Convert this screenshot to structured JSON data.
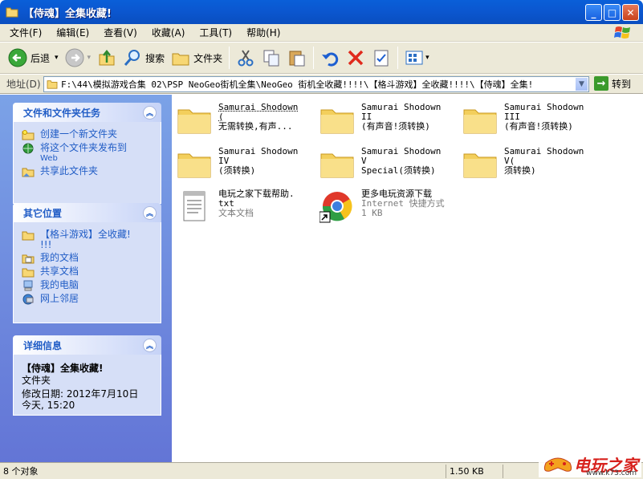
{
  "window": {
    "title": "【侍魂】全集收藏!"
  },
  "window_buttons": {
    "minimize": "_",
    "maximize": "□",
    "close": "✕"
  },
  "menu": [
    "文件(F)",
    "编辑(E)",
    "查看(V)",
    "收藏(A)",
    "工具(T)",
    "帮助(H)"
  ],
  "toolbar": {
    "back": "后退",
    "search": "搜索",
    "folders": "文件夹",
    "back_dropdown": "▾",
    "views_dropdown": "▾"
  },
  "address": {
    "label": "地址(D)",
    "path": "F:\\44\\模拟游戏合集 02\\PSP NeoGeo街机全集\\NeoGeo 街机全收藏!!!!\\【格斗游戏】全收藏!!!!\\【侍魂】全集!",
    "dropdown": "▼",
    "go_icon": "→",
    "go": "转到"
  },
  "tasks": {
    "title": "文件和文件夹任务",
    "collapse": "︽",
    "items": [
      {
        "label": "创建一个新文件夹",
        "sub": ""
      },
      {
        "label": "将这个文件夹发布到",
        "sub": "Web"
      },
      {
        "label": "共享此文件夹",
        "sub": ""
      }
    ]
  },
  "other": {
    "title": "其它位置",
    "collapse": "︽",
    "items": [
      {
        "label": "【格斗游戏】全收藏!",
        "sub": "!!!"
      },
      {
        "label": "我的文档",
        "sub": ""
      },
      {
        "label": "共享文档",
        "sub": ""
      },
      {
        "label": "我的电脑",
        "sub": ""
      },
      {
        "label": "网上邻居",
        "sub": ""
      }
    ]
  },
  "details": {
    "title": "详细信息",
    "collapse": "︽",
    "name": "【侍魂】全集收藏!",
    "type": "文件夹",
    "modified_label": "修改日期:",
    "modified_date": "2012年7月10日",
    "modified_time": "今天, 15:20"
  },
  "files": [
    {
      "line1": "Samurai Shodown (",
      "line2": "无需转换,有声...",
      "sub": "",
      "kind": "folder"
    },
    {
      "line1": "Samurai Shodown II",
      "line2": "(有声音!须转换)",
      "sub": "",
      "kind": "folder"
    },
    {
      "line1": "Samurai Shodown III",
      "line2": "(有声音!须转换)",
      "sub": "",
      "kind": "folder"
    },
    {
      "line1": "Samurai Shodown IV",
      "line2": "(须转换)",
      "sub": "",
      "kind": "folder"
    },
    {
      "line1": "Samurai Shodown V",
      "line2": "Special(须转换)",
      "sub": "",
      "kind": "folder"
    },
    {
      "line1": "Samurai Shodown V(",
      "line2": "须转换)",
      "sub": "",
      "kind": "folder"
    },
    {
      "line1": "电玩之家下载帮助.",
      "line2": "txt",
      "sub": "文本文档",
      "kind": "text"
    },
    {
      "line1": "更多电玩资源下载",
      "line2": "Internet 快捷方式",
      "sub": "1 KB",
      "kind": "shortcut"
    }
  ],
  "status": {
    "count": "8 个对象",
    "size": "1.50 KB"
  },
  "watermark": {
    "text": "电玩之家",
    "url": "www.k73.com"
  }
}
